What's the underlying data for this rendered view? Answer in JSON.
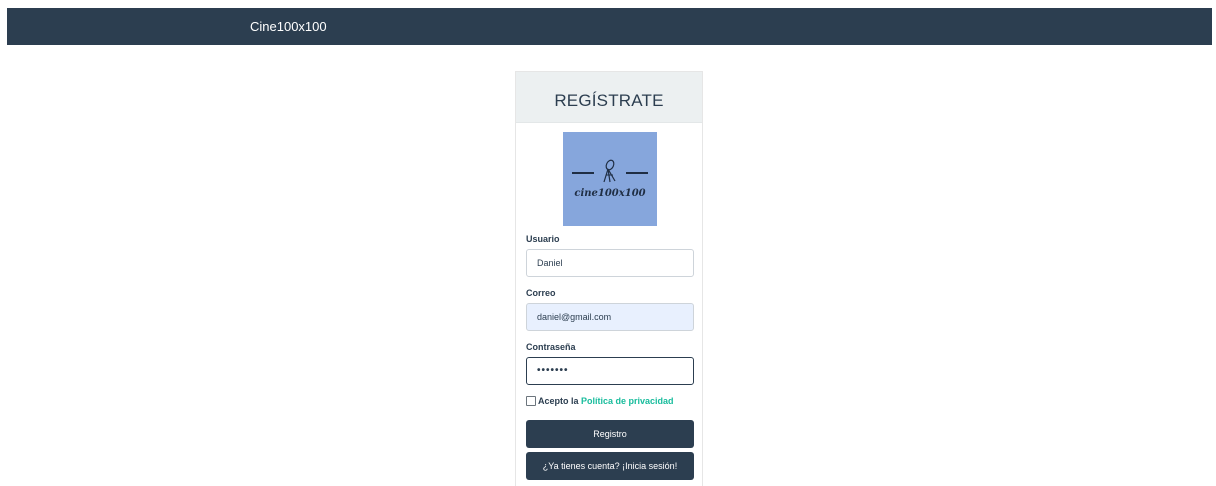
{
  "navbar": {
    "brand": "Cine100x100"
  },
  "register_card": {
    "title": "REGÍSTRATE",
    "logo_text": "cine100x100",
    "fields": {
      "username": {
        "label": "Usuario",
        "value": "Daniel"
      },
      "email": {
        "label": "Correo",
        "value": "daniel@gmail.com"
      },
      "password": {
        "label": "Contraseña",
        "value": "•••••••"
      }
    },
    "privacy": {
      "prefix": "Acepto la ",
      "link": "Política de privacidad",
      "checked": false
    },
    "register_button": "Registro",
    "login_button": "¿Ya tienes cuenta? ¡Inicia sesión!"
  },
  "colors": {
    "primary": "#2c3e50",
    "link": "#18bc9c",
    "header_bg": "#ecf0f1",
    "logo_bg": "#86a6dc",
    "autofill": "#e8f0fe"
  }
}
